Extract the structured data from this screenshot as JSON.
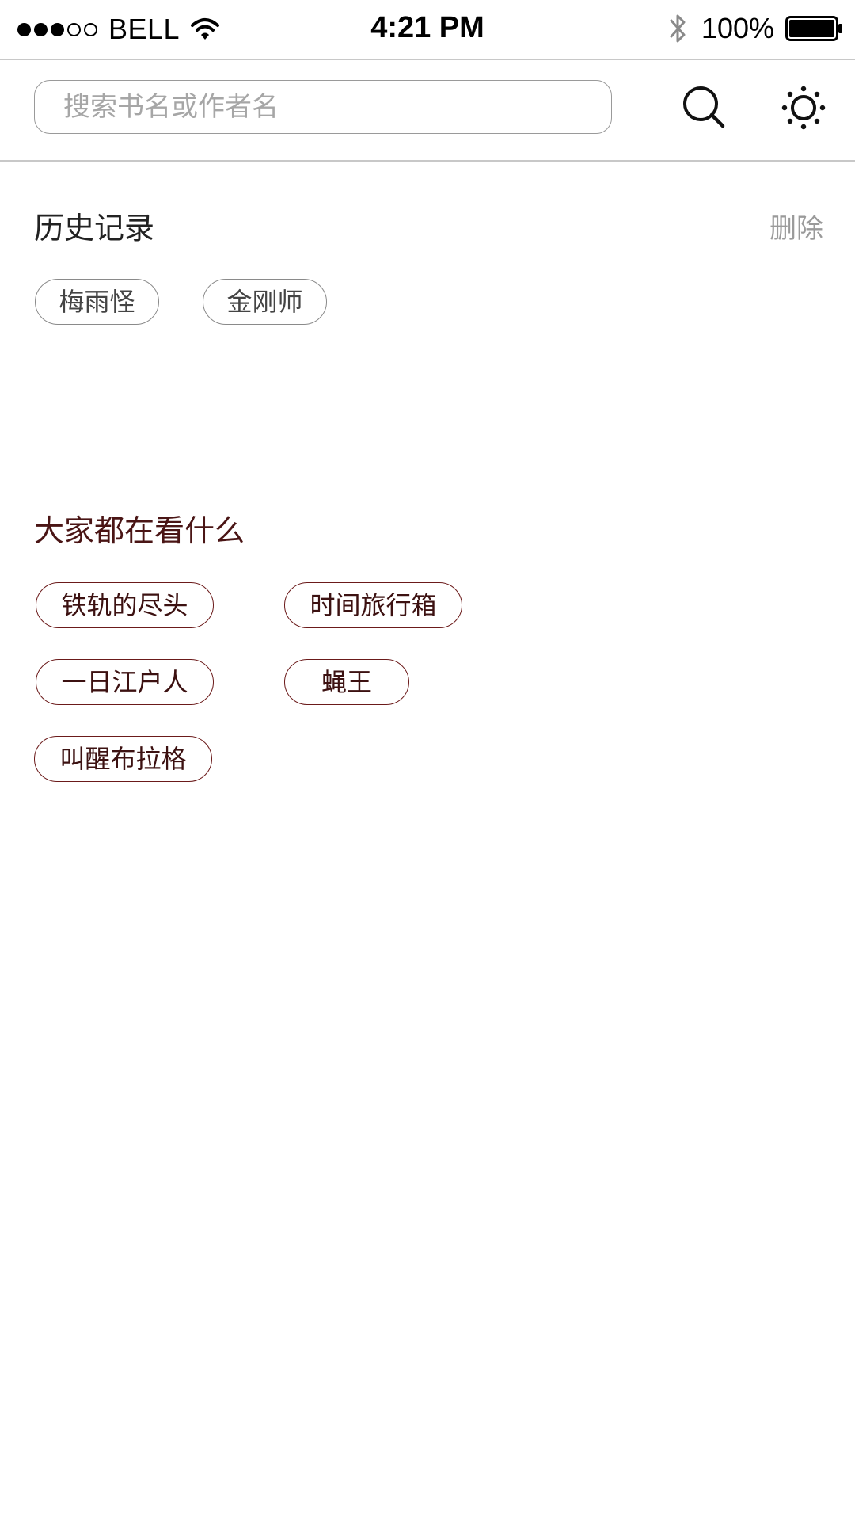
{
  "status_bar": {
    "signal_dots": [
      true,
      true,
      true,
      false,
      false
    ],
    "carrier": "BELL",
    "time": "4:21 PM",
    "battery": "100%"
  },
  "search": {
    "placeholder": "搜索书名或作者名"
  },
  "history": {
    "title": "历史记录",
    "delete_label": "删除",
    "items": [
      "梅雨怪",
      "金刚师"
    ]
  },
  "popular": {
    "title": "大家都在看什么",
    "items": [
      "铁轨的尽头",
      "时间旅行箱",
      "一日江户人",
      "蝇王",
      "叫醒布拉格"
    ]
  },
  "colors": {
    "popular_accent": "#6b1a1a",
    "history_border": "#8a8a8a",
    "muted_text": "#9a9a9a"
  },
  "icons": {
    "search_button": "search-icon",
    "settings_button": "sun-icon",
    "status": [
      "wifi-icon",
      "bluetooth-icon",
      "battery-icon"
    ]
  }
}
